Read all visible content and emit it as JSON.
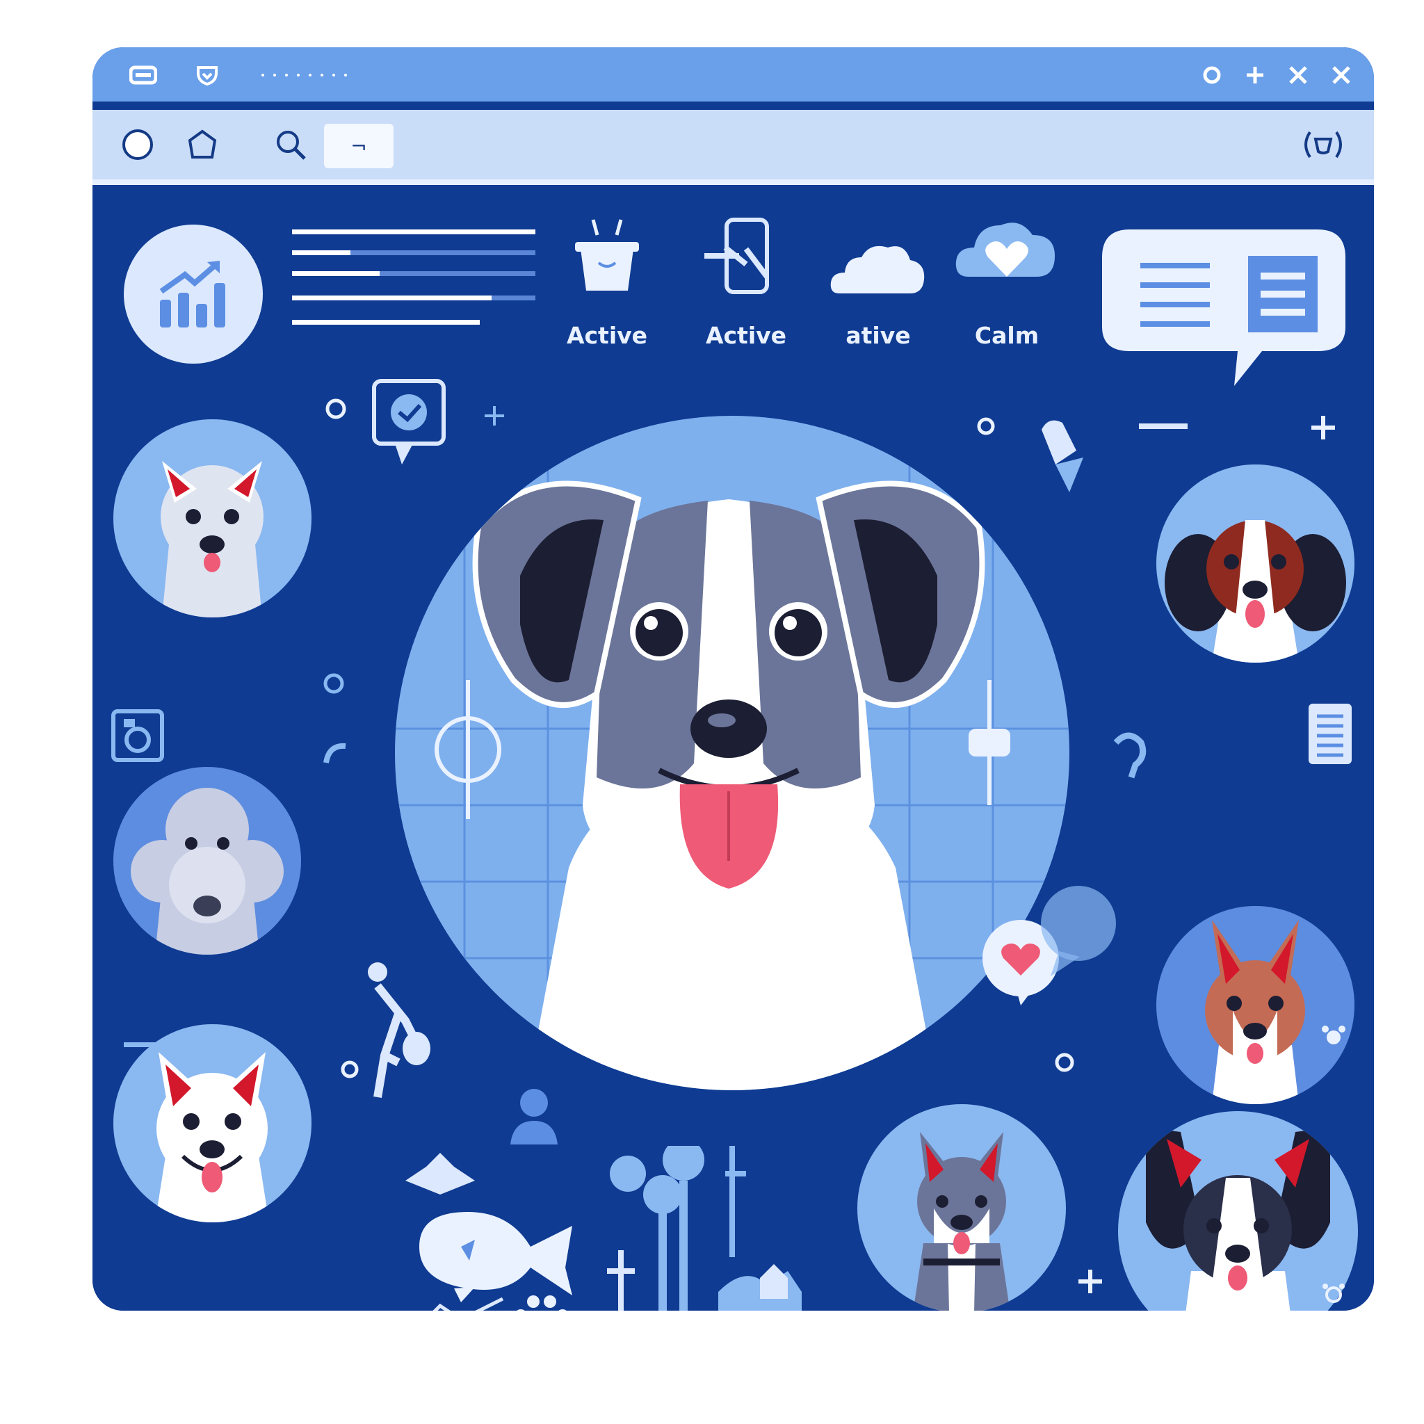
{
  "window": {
    "title_controls": [
      "settings-icon",
      "add-icon",
      "close-icon",
      "close-icon"
    ]
  },
  "toolbar": {
    "nav_icons": [
      "back-circle-icon",
      "home-shield-icon",
      "search-icon"
    ],
    "search_value": "¬",
    "right_icon": "broadcast-icon"
  },
  "mood_chips": [
    {
      "icon": "bowl-icon",
      "label": "Active"
    },
    {
      "icon": "phone-touch-icon",
      "label": "Active"
    },
    {
      "icon": "cloud-icon",
      "label": "ative"
    },
    {
      "icon": "cloud-heart-icon",
      "label": "Calm"
    }
  ],
  "stats": {
    "icon": "growth-chart-icon",
    "bars_fill": [
      1.0,
      0.24,
      0.36,
      0.82,
      0.77
    ]
  },
  "colors": {
    "background": "#0f3b92",
    "titlebar": "#6aa0ea",
    "toolbar": "#c9dcf8",
    "circle_fill": "#8ab8f1",
    "accent_light": "#dbe8fd",
    "tongue": "#ef5a76",
    "ear_red": "#d3182c"
  },
  "dogs": {
    "featured": {
      "name": "dog-main-portrait",
      "icon": "dog-face-icon"
    },
    "gallery": [
      "dog-white-red-ears",
      "dog-poodle",
      "dog-white-husky",
      "dog-spaniel",
      "dog-corgi",
      "dog-husky-collar",
      "dog-black-ears"
    ]
  },
  "decorations": [
    "heart-speech-icon",
    "paw-icon",
    "fish-icon",
    "tree-icon",
    "person-icon",
    "document-icon",
    "chat-bubble-icon"
  ]
}
